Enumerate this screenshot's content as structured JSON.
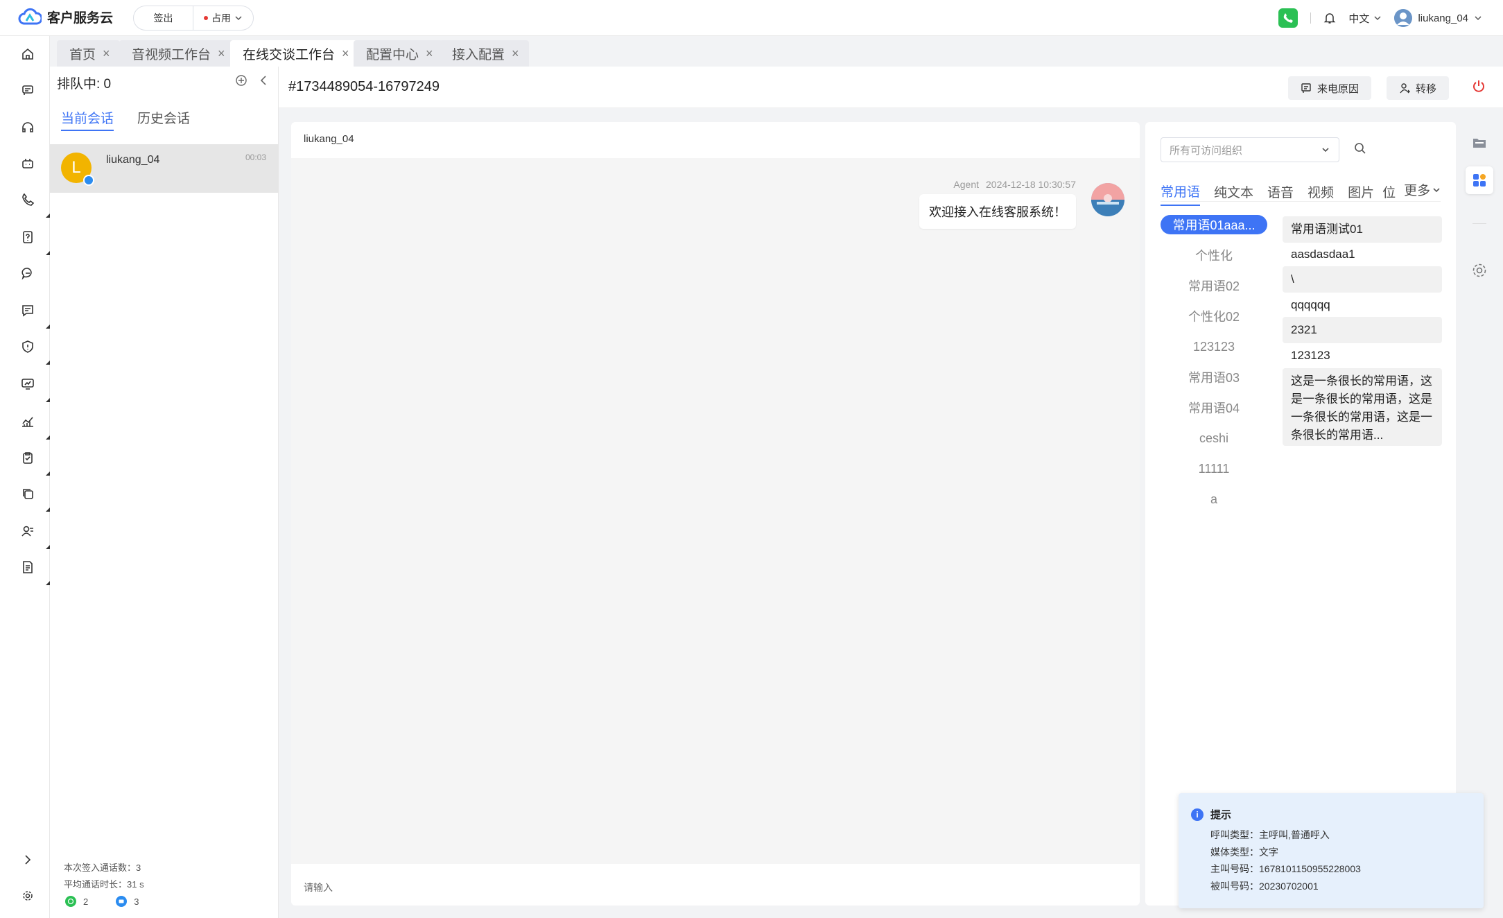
{
  "brand": {
    "name": "客户服务云"
  },
  "status": {
    "signout_label": "签出",
    "busy_label": "占用"
  },
  "header": {
    "language": "中文",
    "username": "liukang_04"
  },
  "tabs": [
    {
      "label": "首页"
    },
    {
      "label": "音视频工作台"
    },
    {
      "label": "在线交谈工作台"
    },
    {
      "label": "配置中心"
    },
    {
      "label": "接入配置"
    }
  ],
  "sessions": {
    "queue_label": "排队中: 0",
    "tab_current": "当前会话",
    "tab_history": "历史会话",
    "item": {
      "avatar_letter": "L",
      "name": "liukang_04",
      "time": "00:03"
    },
    "stats": {
      "signin_count": "本次签入通话数：3",
      "avg_duration": "平均通话时长：31 s"
    },
    "channel_counts": {
      "whatsapp": "2",
      "chat": "3"
    }
  },
  "conversation": {
    "id": "#1734489054-16797249",
    "call_reason_label": "来电原因",
    "transfer_label": "转移",
    "user": "liukang_04",
    "message": {
      "sender": "Agent",
      "time": "2024-12-18 10:30:57",
      "text": "欢迎接入在线客服系统！"
    },
    "input_placeholder": "请输入"
  },
  "quick_replies": {
    "org_placeholder": "所有可访问组织",
    "tabs": [
      "常用语",
      "纯文本",
      "语音",
      "视频",
      "图片",
      "位"
    ],
    "more_label": "更多",
    "categories": [
      "常用语01aaa...",
      "个性化",
      "常用语02",
      "个性化02",
      "123123",
      "常用语03",
      "常用语04",
      "ceshi",
      "11111",
      "a"
    ],
    "items": [
      "常用语测试01",
      "aasdasdaa1",
      "\\",
      "qqqqqq",
      "2321",
      "123123",
      "这是一条很长的常用语，这是一条很长的常用语，这是一条很长的常用语，这是一条很长的常用语..."
    ]
  },
  "notice": {
    "title": "提示",
    "call_type": "呼叫类型：主呼叫,普通呼入",
    "media_type": "媒体类型：文字",
    "caller": "主叫号码：1678101150955228003",
    "callee": "被叫号码：20230702001"
  },
  "colors": {
    "accent": "#3e74f5",
    "phone_green": "#2bc054",
    "avatar_yellow": "#f2b400"
  }
}
